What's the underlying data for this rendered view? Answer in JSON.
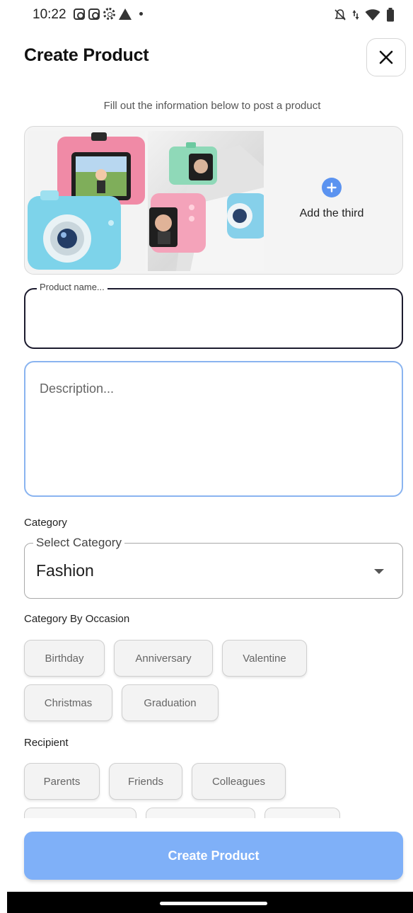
{
  "status_bar": {
    "time": "10:22",
    "left_icons": [
      "instagram-icon",
      "instagram-icon",
      "settings-gear-icon",
      "warning-icon",
      "notification-dot-icon"
    ],
    "right_icons": [
      "bell-off-icon",
      "data-arrows-icon",
      "wifi-icon",
      "battery-icon"
    ]
  },
  "header": {
    "title": "Create Product",
    "close_icon": "close-icon"
  },
  "subtitle": "Fill out the information below to post a product",
  "image_picker": {
    "photos": [
      "kids-camera-photo-1",
      "kids-camera-photo-2"
    ],
    "add_label": "Add the third",
    "add_icon": "plus-circle-icon"
  },
  "form": {
    "product_name": {
      "label": "Product name...",
      "value": ""
    },
    "description": {
      "placeholder": "Description...",
      "value": ""
    },
    "category": {
      "section_label": "Category",
      "select_label": "Select Category",
      "value": "Fashion",
      "arrow_icon": "dropdown-arrow-icon"
    },
    "occasion": {
      "section_label": "Category By Occasion",
      "chips": [
        "Birthday",
        "Anniversary",
        "Valentine",
        "Christmas",
        "Graduation"
      ]
    },
    "recipient": {
      "section_label": "Recipient",
      "chips": [
        "Parents",
        "Friends",
        "Colleagues"
      ]
    }
  },
  "submit": {
    "label": "Create Product"
  },
  "colors": {
    "accent_blue": "#5b93f0",
    "button_blue": "#7fb0f8",
    "focused_border": "#1c1b2e",
    "description_border": "#8ab4f0"
  }
}
